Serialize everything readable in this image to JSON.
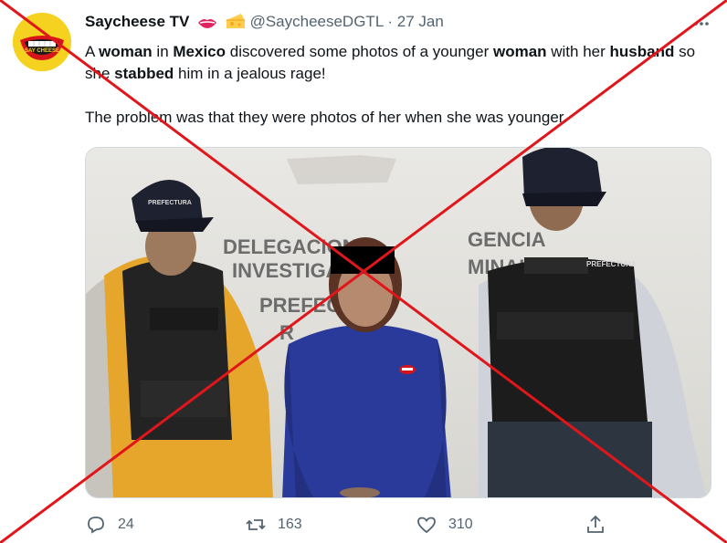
{
  "tweet": {
    "display_name": "Saycheese TV",
    "handle": "@SaycheeseDGTL",
    "separator": "·",
    "date": "27 Jan",
    "text_parts": [
      {
        "t": "A ",
        "b": false
      },
      {
        "t": "woman",
        "b": true
      },
      {
        "t": " in ",
        "b": false
      },
      {
        "t": "Mexico",
        "b": true
      },
      {
        "t": " discovered some photos of a younger ",
        "b": false
      },
      {
        "t": "woman",
        "b": true
      },
      {
        "t": " with her ",
        "b": false
      },
      {
        "t": "husband",
        "b": true
      },
      {
        "t": " so she ",
        "b": false
      },
      {
        "t": "stabbed",
        "b": true
      },
      {
        "t": " him in a jealous rage!\n\nThe problem was that they were photos of her when she was younger.",
        "b": false
      }
    ],
    "avatar_text": "SAY CHEESE",
    "icons": {
      "lips": "lips-emoji-icon",
      "cheese": "cheese-emoji-icon",
      "more": "more-options-icon"
    }
  },
  "media": {
    "wall_text": [
      "DELEGACION",
      "GENCIA",
      "INVESTIGA",
      "MINAL",
      "PREFEC",
      "R"
    ],
    "vest_text": "PREFECTURA",
    "cap_text": "PREFECTURA"
  },
  "actions": {
    "reply": {
      "icon": "reply-icon",
      "count": "24"
    },
    "retweet": {
      "icon": "retweet-icon",
      "count": "163"
    },
    "like": {
      "icon": "like-icon",
      "count": "310"
    },
    "share": {
      "icon": "share-icon"
    }
  },
  "overlay": {
    "color": "#e0161b"
  }
}
